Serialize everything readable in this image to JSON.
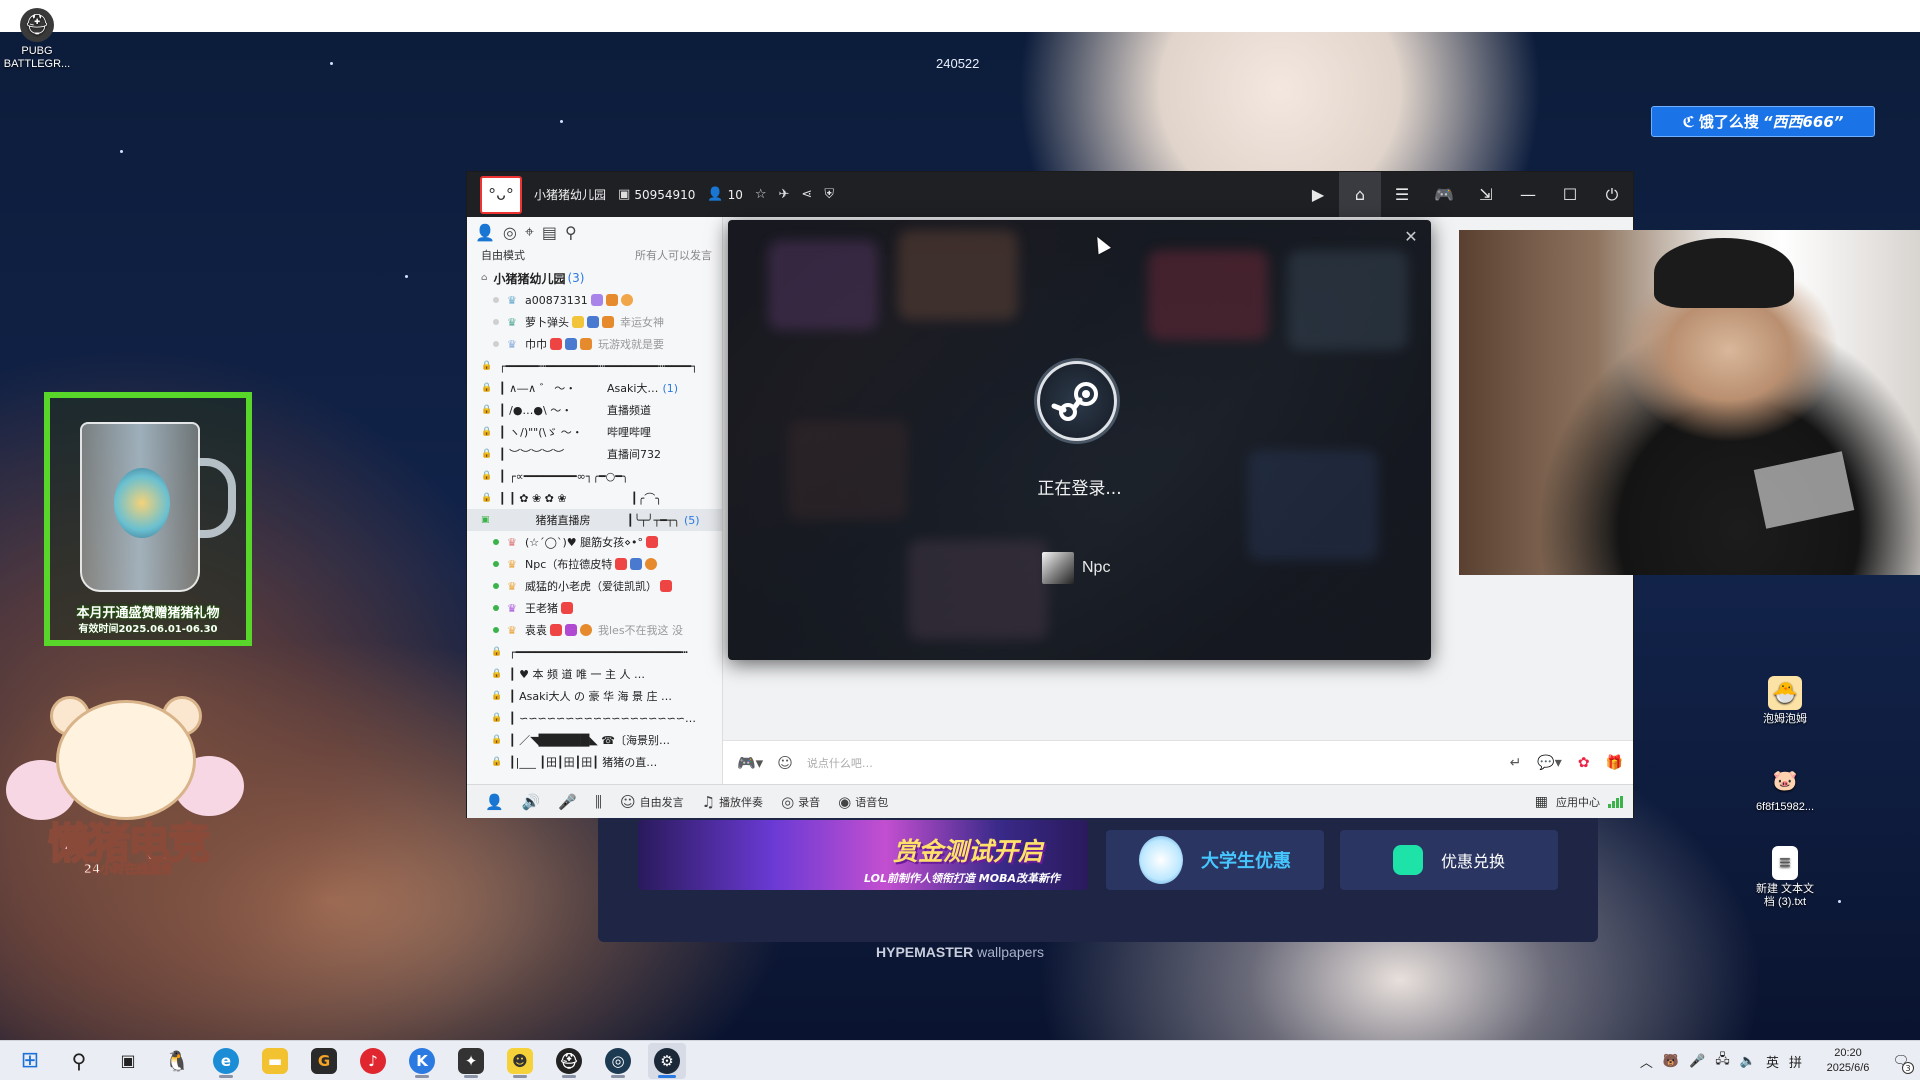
{
  "desktop": {
    "wallpaper_code": "240522",
    "wallpaper_credit_brand": "HYPEMASTER",
    "wallpaper_credit_rest": " wallpapers",
    "icons_left": [
      {
        "label_line1": "PUBG",
        "label_line2": "BATTLEGR...",
        "icon": "pubg-icon"
      }
    ],
    "icons_right": [
      {
        "label_line1": "泡姆泡姆",
        "label_line2": "",
        "icon": "paopao-game-icon"
      },
      {
        "label_line1": "6f8f15982...",
        "label_line2": "",
        "icon": "image-file-icon"
      },
      {
        "label_line1": "新建 文本文",
        "label_line2": "档 (3).txt",
        "icon": "text-file-icon"
      }
    ]
  },
  "overlay": {
    "eleme_prefix": "饿了么搜",
    "eleme_query": "“西西666”",
    "mug_caption": "本月开通盛赞赠猪猪礼物",
    "mug_period": "有效时间2025.06.01-06.30",
    "bear_title": "懒猪电竞",
    "bear_subtitle": "24小时在线服务"
  },
  "app": {
    "room_name": "小猪猪幼儿园",
    "room_id": "50954910",
    "online_count": "10",
    "sidebar": {
      "mode_label": "自由模式",
      "mode_right": "所有人可以发言",
      "channel_name": "小猪猪幼儿园",
      "channel_count": "(3)",
      "members": [
        {
          "name": "a00873131",
          "extra": ""
        },
        {
          "name": "萝卜弹头",
          "extra": "幸运女神"
        },
        {
          "name": "巾巾",
          "extra": "玩游戏就是要"
        }
      ],
      "deco_rows": [
        {
          "left": "┌━━━━━┅━━━━━━━━┅━━━━━━━━┅━━━━┐",
          "right": "",
          "num": ""
        },
        {
          "left": "┃   ∧―∧ ゛    ～・",
          "right": "Asaki大…",
          "num": "(1)"
        },
        {
          "left": "┃   /●…●\\    ～・",
          "right": "直播频道",
          "num": ""
        },
        {
          "left": "┃   ヽ/)\"\"(\\ゞ   ～・",
          "right": "哔哩哔哩",
          "num": ""
        },
        {
          "left": "┃ ︶︶︶︶︶",
          "right": "直播间732",
          "num": ""
        },
        {
          "left": "┃ ┌∝━━━━━━━━∞┐╭━○━╮",
          "right": "",
          "num": ""
        },
        {
          "left": "┃ ┃ ✿   ❀   ✿   ❀",
          "right": "┃╭⌒╮",
          "num": ""
        }
      ],
      "selected_channel": "猪猪直播房",
      "selected_channel_extra": "┃╰┬╯┬━┬╮",
      "selected_count": "(5)",
      "live_members": [
        {
          "name": "(☆´◯`)♥ 腿筋女孩⋄•°",
          "extra": ""
        },
        {
          "name": "Npc（布拉德皮特",
          "extra": ""
        },
        {
          "name": "威猛的小老虎（爱徒凯凯）",
          "extra": ""
        },
        {
          "name": "王老猪",
          "extra": ""
        },
        {
          "name": "袁袁",
          "extra": "我les不在我这 没"
        }
      ],
      "bottom_rows": [
        "┌━━━━━━━━━━━━━━━━━━━━━━━━━┅",
        "┃ ♥   本 频 道 唯 一 主 人   …",
        "┃  Asaki大人 の 豪 华 海 景 庄 …",
        "┃ ∽∽∽∽∽∽∽∽∽∽∽∽∽∽∽∽∽∽…",
        "┃ ／◥██████◣   ☎〔海景别…",
        "┃|___  ┃田┃田┃田┃  猪猪の直…"
      ]
    },
    "input_placeholder": "说点什么吧…",
    "bottom_bar": {
      "free_speak": "自由发言",
      "play_music": "播放伴奏",
      "record": "录音",
      "voice_pack": "语音包",
      "app_center": "应用中心"
    }
  },
  "steam_dialog": {
    "status": "正在登录...",
    "username": "Npc"
  },
  "promos": {
    "game_banner_big": "赏金测试开启",
    "game_banner_small": "LOL前制作人领衔打造 MOBA改革新作",
    "student": "大学生优惠",
    "redeem": "优惠兑换"
  },
  "taskbar": {
    "time": "20:20",
    "date": "2025/6/6",
    "ime": "英",
    "notification_count": "3"
  },
  "colors": {
    "app_titlebar": "#1f2024",
    "steam_bg": "#1a2230",
    "online_dot": "#3bb34a",
    "eleme_blue": "#1a74e8",
    "promo_panel": "#1e2545"
  }
}
